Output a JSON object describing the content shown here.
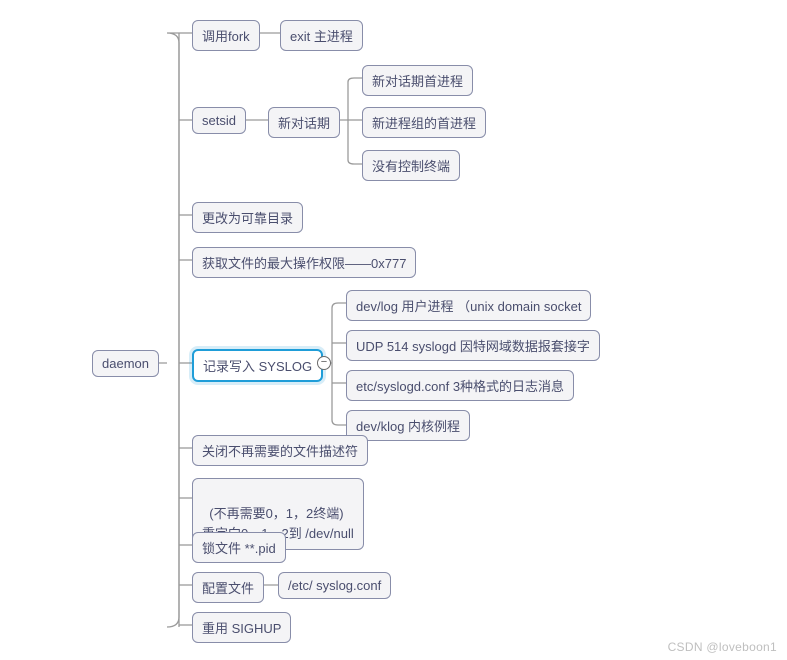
{
  "root": {
    "label": "daemon"
  },
  "children": [
    {
      "label": "调用fork",
      "children": [
        {
          "label": "exit 主进程"
        }
      ]
    },
    {
      "label": "setsid",
      "children": [
        {
          "label": "新对话期",
          "children": [
            {
              "label": "新对话期首进程"
            },
            {
              "label": "新进程组的首进程"
            },
            {
              "label": "没有控制终端"
            }
          ]
        }
      ]
    },
    {
      "label": "更改为可靠目录"
    },
    {
      "label": "获取文件的最大操作权限——0x777"
    },
    {
      "label": "记录写入 SYSLOG",
      "selected": true,
      "children": [
        {
          "label": "dev/log  用户进程   （unix domain socket"
        },
        {
          "label": "UDP 514 syslogd 因特网域数据报套接字"
        },
        {
          "label": "etc/syslogd.conf  3种格式的日志消息"
        },
        {
          "label": "dev/klog 内核例程"
        }
      ]
    },
    {
      "label": "关闭不再需要的文件描述符"
    },
    {
      "label": "(不再需要0，1，2终端)\n重定向0，1，2到 /dev/null"
    },
    {
      "label": "锁文件  **.pid"
    },
    {
      "label": "配置文件",
      "children": [
        {
          "label": "/etc/  syslog.conf"
        }
      ]
    },
    {
      "label": "重用 SIGHUP"
    }
  ],
  "watermark": "CSDN @loveboon1"
}
